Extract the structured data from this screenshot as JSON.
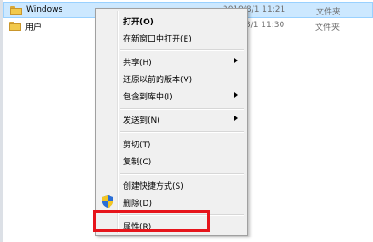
{
  "files": [
    {
      "name": "Windows",
      "date": "2019/8/1 11:21",
      "type": "文件夹",
      "selected": true
    },
    {
      "name": "用户",
      "date": "2019/8/1 11:30",
      "type": "文件夹",
      "selected": false
    }
  ],
  "menu": {
    "items": [
      {
        "label": "打开(O)",
        "bold": true
      },
      {
        "label": "在新窗口中打开(E)"
      },
      {
        "label": "共享(H)",
        "submenu": true
      },
      {
        "label": "还原以前的版本(V)"
      },
      {
        "label": "包含到库中(I)",
        "submenu": true
      },
      {
        "label": "发送到(N)",
        "submenu": true
      },
      {
        "label": "剪切(T)"
      },
      {
        "label": "复制(C)"
      },
      {
        "label": "创建快捷方式(S)"
      },
      {
        "label": "删除(D)",
        "icon": "uac-shield-icon"
      },
      {
        "label": "属性(R)"
      }
    ]
  },
  "colors": {
    "highlight": "#e6141b",
    "selection": "#cce8ff",
    "folder": "#f2c94c"
  }
}
